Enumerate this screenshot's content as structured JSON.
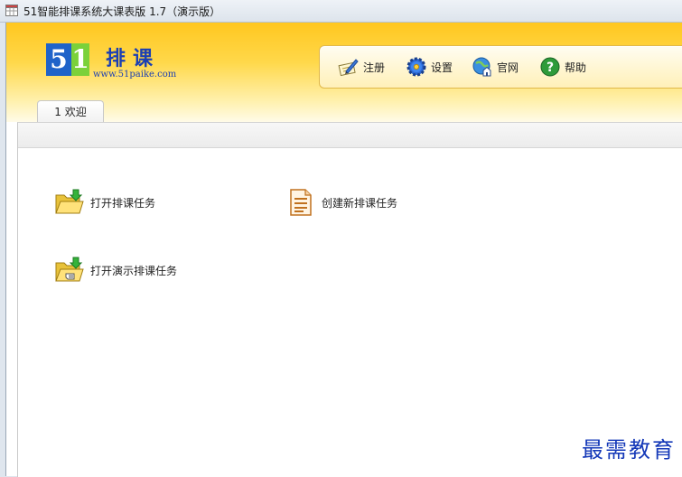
{
  "window": {
    "title": "51智能排课系统大课表版 1.7（演示版）"
  },
  "logo": {
    "digit_5": "5",
    "digit_1": "1",
    "name": "排课",
    "url": "www.51paike.com"
  },
  "toolbar": {
    "register": "注册",
    "settings": "设置",
    "website": "官网",
    "help": "帮助"
  },
  "tabs": [
    {
      "label": "1 欢迎"
    }
  ],
  "actions": {
    "open_task": "打开排课任务",
    "new_task": "创建新排课任务",
    "open_demo": "打开演示排课任务"
  },
  "watermark": "最需教育",
  "colors": {
    "header_top": "#ffc720",
    "logo_blue": "#1f63c9",
    "logo_green": "#7bd13a",
    "logo_text": "#1b3fb3",
    "watermark": "#1438b8"
  }
}
